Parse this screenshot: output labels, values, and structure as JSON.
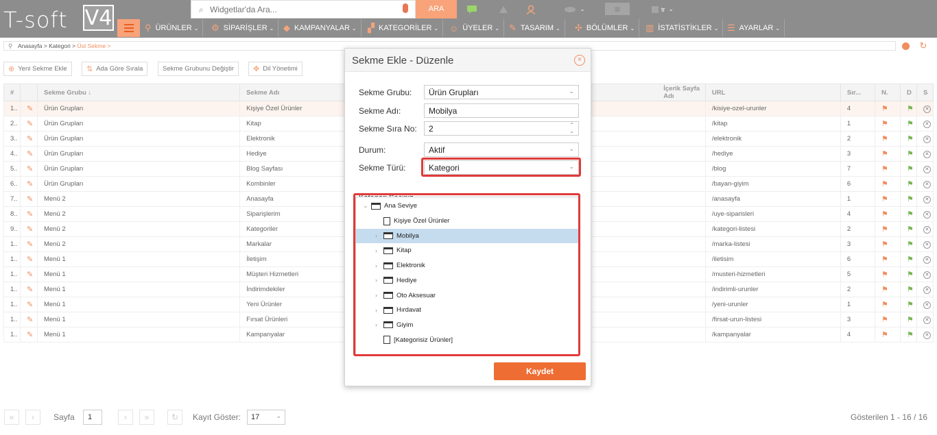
{
  "app": {
    "logo_text": "T-soft",
    "logo_version": "V4"
  },
  "search": {
    "placeholder": "Widgetlar'da Ara...",
    "button_label": "ARA"
  },
  "top_lang": "tr",
  "nav": [
    {
      "label": "ÜRÜNLER",
      "icon": "shirt-icon"
    },
    {
      "label": "SİPARİŞLER",
      "icon": "cart-icon"
    },
    {
      "label": "KAMPANYALAR",
      "icon": "tag-icon"
    },
    {
      "label": "KATEGORİLER",
      "icon": "sitemap-icon"
    },
    {
      "label": "ÜYELER",
      "icon": "user-icon"
    },
    {
      "label": "TASARIM",
      "icon": "brush-icon"
    },
    {
      "label": "BÖLÜMLER",
      "icon": "blocks-icon"
    },
    {
      "label": "İSTATİSTİKLER",
      "icon": "chart-icon"
    },
    {
      "label": "AYARLAR",
      "icon": "settings-icon"
    }
  ],
  "breadcrumb": {
    "p1": "Anasayfa",
    "sep": " > ",
    "p2": "Kategori",
    "p3": "Üst Sekme",
    "end": " >"
  },
  "toolbar": {
    "new_tab": "Yeni Sekme Ekle",
    "sort_name": "Ada Göre Sırala",
    "change_group": "Sekme Grubunu Değiştir",
    "lang_mgmt": "Dil Yönetimi"
  },
  "table": {
    "headers": {
      "num": "#",
      "group": "Sekme Grubu",
      "name": "Sekme Adı",
      "content": "İçerik Sayfa Adı",
      "url": "URL",
      "order": "Sır...",
      "n": "N.",
      "d": "D",
      "s": "S"
    },
    "rows": [
      {
        "num": "1..",
        "group": "Ürün Grupları",
        "name": "Kişiye Özel Ürünler",
        "url": "/kisiye-ozel-urunler",
        "order": "4"
      },
      {
        "num": "2..",
        "group": "Ürün Grupları",
        "name": "Kitap",
        "url": "/kitap",
        "order": "1"
      },
      {
        "num": "3..",
        "group": "Ürün Grupları",
        "name": "Elektronik",
        "url": "/elektronik",
        "order": "2"
      },
      {
        "num": "4..",
        "group": "Ürün Grupları",
        "name": "Hediye",
        "url": "/hediye",
        "order": "3"
      },
      {
        "num": "5..",
        "group": "Ürün Grupları",
        "name": "Blog Sayfası",
        "url": "/blog",
        "order": "7"
      },
      {
        "num": "6..",
        "group": "Ürün Grupları",
        "name": "Kombinler",
        "url": "/bayan-giyim",
        "order": "6"
      },
      {
        "num": "7..",
        "group": "Menü 2",
        "name": "Anasayfa",
        "url": "/anasayfa",
        "order": "1"
      },
      {
        "num": "8..",
        "group": "Menü 2",
        "name": "Siparişlerim",
        "url": "/uye-siparisleri",
        "order": "4"
      },
      {
        "num": "9..",
        "group": "Menü 2",
        "name": "Kategoriler",
        "url": "/kategori-listesi",
        "order": "2"
      },
      {
        "num": "1..",
        "group": "Menü 2",
        "name": "Markalar",
        "url": "/marka-listesi",
        "order": "3"
      },
      {
        "num": "1..",
        "group": "Menü 1",
        "name": "İletişim",
        "url": "/iletisim",
        "order": "6"
      },
      {
        "num": "1..",
        "group": "Menü 1",
        "name": "Müşteri Hizmetleri",
        "url": "/musteri-hizmetleri",
        "order": "5"
      },
      {
        "num": "1..",
        "group": "Menü 1",
        "name": "İndirimdekiler",
        "url": "/indirimli-urunler",
        "order": "2"
      },
      {
        "num": "1..",
        "group": "Menü 1",
        "name": "Yeni Ürünler",
        "url": "/yeni-urunler",
        "order": "1"
      },
      {
        "num": "1..",
        "group": "Menü 1",
        "name": "Fırsat Ürünleri",
        "url": "/firsat-urun-listesi",
        "order": "3"
      },
      {
        "num": "1..",
        "group": "Menü 1",
        "name": "Kampanyalar",
        "url": "/kampanyalar",
        "order": "4"
      }
    ]
  },
  "pager": {
    "page_label": "Sayfa",
    "page_value": "1",
    "records_label": "Kayıt Göster:",
    "records_value": "17",
    "shown": "Gösterilen 1 - 16 / 16"
  },
  "modal": {
    "title": "Sekme Ekle - Düzenle",
    "fields": {
      "group_label": "Sekme Grubu:",
      "group_value": "Ürün Grupları",
      "name_label": "Sekme Adı:",
      "name_value": "Mobilya",
      "order_label": "Sekme Sıra No:",
      "order_value": "2",
      "status_label": "Durum:",
      "status_value": "Aktif",
      "type_label": "Sekme Türü:",
      "type_value": "Kategori"
    },
    "tree_label": "Kategori Seçiniz",
    "tree": {
      "root": "Ana Seviye",
      "items": [
        {
          "label": "Kişiye Özel Ürünler",
          "type": "doc"
        },
        {
          "label": "Mobilya",
          "type": "folder",
          "selected": true
        },
        {
          "label": "Kitap",
          "type": "folder"
        },
        {
          "label": "Elektronik",
          "type": "folder"
        },
        {
          "label": "Hediye",
          "type": "folder"
        },
        {
          "label": "Oto Aksesuar",
          "type": "folder"
        },
        {
          "label": "Hırdavat",
          "type": "folder"
        },
        {
          "label": "Giyim",
          "type": "folder"
        },
        {
          "label": "[Kategorisiz Ürünler]",
          "type": "doc"
        }
      ]
    },
    "save_label": "Kaydet"
  },
  "colors": {
    "accent": "#ee6d33",
    "topbar": "#8d8d8d",
    "highlight": "#e03a3a",
    "selected": "#c5dcef"
  }
}
